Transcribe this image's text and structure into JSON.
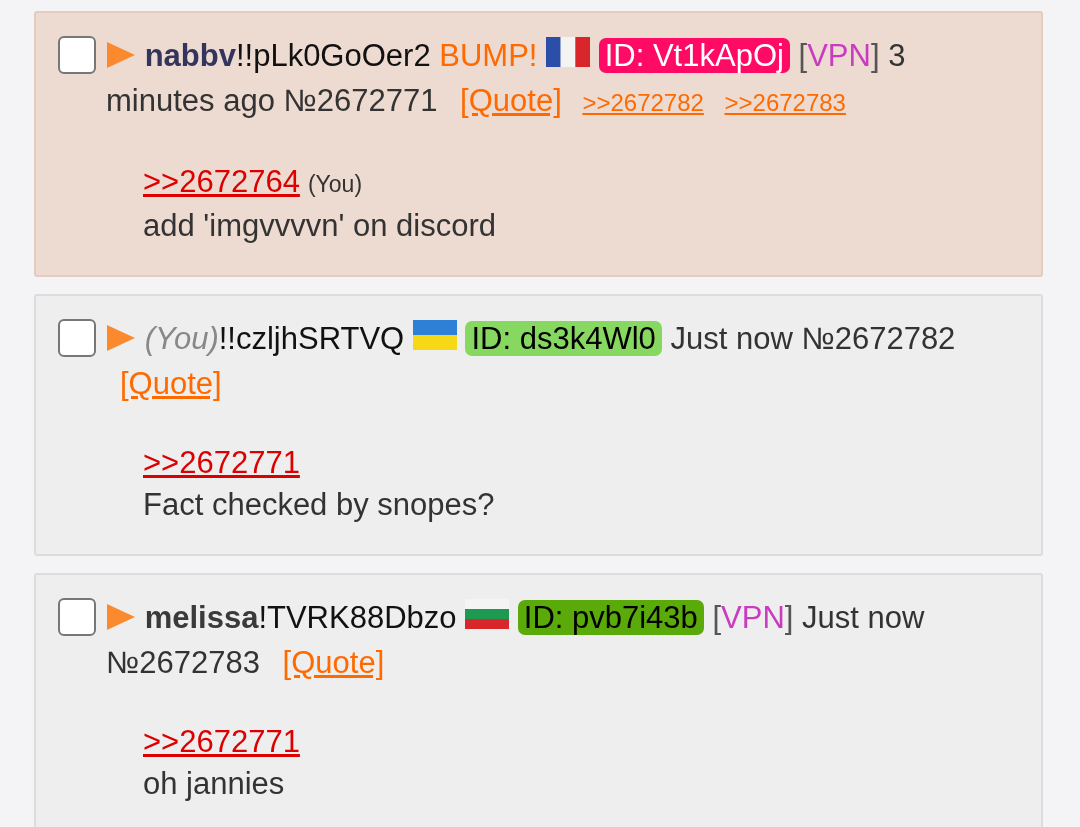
{
  "posts": [
    {
      "highlighted": true,
      "checked": false,
      "name": {
        "kind": "name",
        "text": "nabbv",
        "color": "#34345c"
      },
      "tripcode": "!!pLk0GoOer2",
      "bump": "BUMP!",
      "flag": {
        "kind": "fr"
      },
      "id": {
        "text": "ID: Vt1kApOj",
        "color": "#ff0a64"
      },
      "vpn": {
        "open": "[",
        "text": "VPN",
        "close": "]"
      },
      "time": [
        "3",
        "minutes ago"
      ],
      "number": "№2672771",
      "quote": "[Quote]",
      "backlinks": [
        ">>2672782",
        ">>2672783"
      ],
      "reply": ">>2672764",
      "reply_you": "(You)",
      "text": "add 'imgvvvvn' on discord"
    },
    {
      "highlighted": false,
      "checked": false,
      "name": {
        "kind": "you",
        "text": "(You)",
        "color": "#888888"
      },
      "tripcode": "!!czljhSRTVQ",
      "flag": {
        "kind": "ua"
      },
      "id": {
        "text": "ID: ds3k4Wl0",
        "color": "#86d860"
      },
      "time": [
        "Just",
        "now"
      ],
      "number": "№2672782",
      "quote": "[Quote]",
      "reply": ">>2672771",
      "text": "Fact checked by snopes?"
    },
    {
      "highlighted": false,
      "checked": false,
      "name": {
        "kind": "name",
        "text": "melissa",
        "color": "#3a3a3a"
      },
      "tripcode": "!TVRK88Dbzo",
      "flag": {
        "kind": "bg"
      },
      "id": {
        "text": "ID: pvb7i43b",
        "color": "#5aaa0a"
      },
      "vpn": {
        "open": "[",
        "text": "VPN",
        "close": "]"
      },
      "time": [
        "Just",
        "now"
      ],
      "number": "№2672783",
      "quote": "[Quote]",
      "reply": ">>2672771",
      "text": "oh jannies"
    }
  ]
}
